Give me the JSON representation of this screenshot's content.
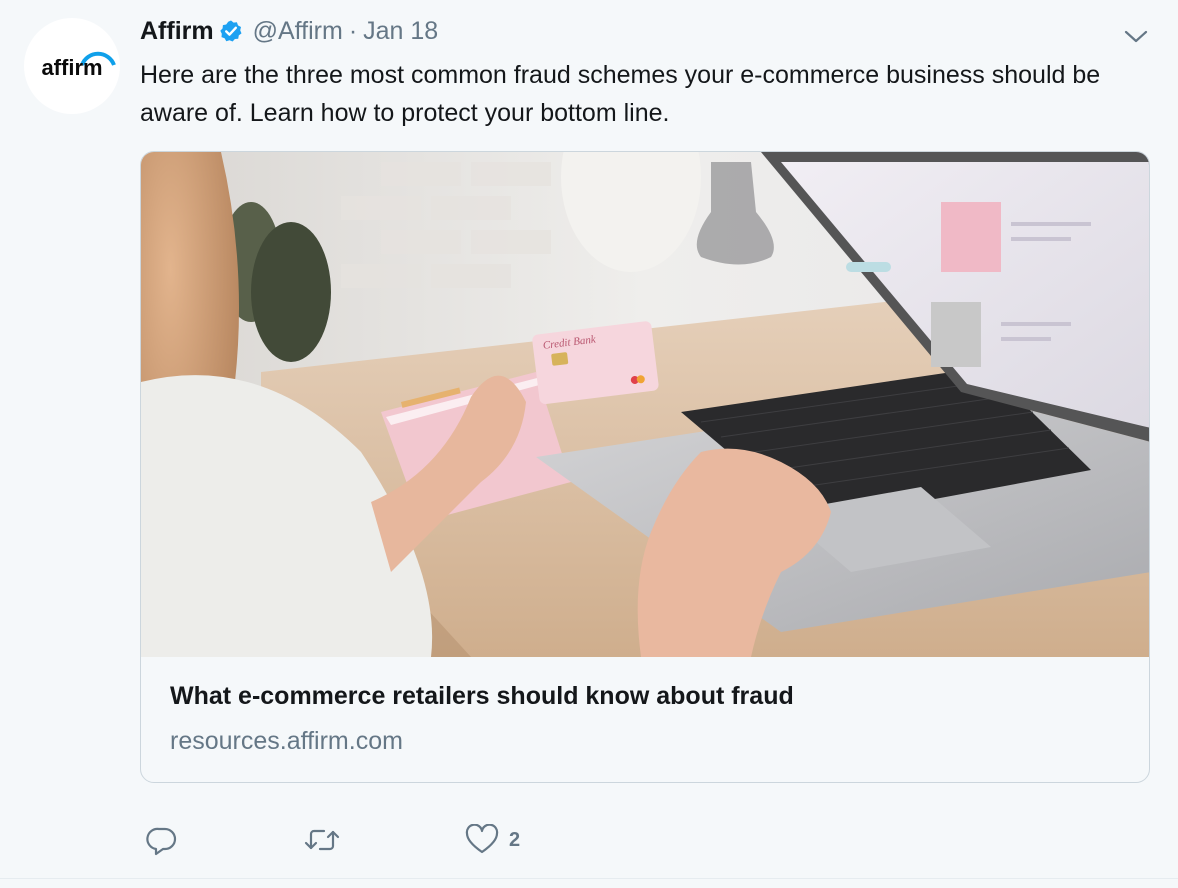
{
  "tweet": {
    "avatar_text": "affirm",
    "name": "Affirm",
    "handle": "@Affirm",
    "separator": "·",
    "date": "Jan 18",
    "text": "Here are the three most common fraud schemes your e-commerce business should be aware of. Learn how to protect your bottom line.",
    "card": {
      "image_card_text": "Credit Bank",
      "title": "What e-commerce retailers should know about fraud",
      "domain": "resources.affirm.com"
    },
    "actions": {
      "like_count": "2"
    }
  },
  "colors": {
    "background": "#f5f8fa",
    "text": "#14171a",
    "secondary": "#657786",
    "verified": "#1da1f2",
    "affirm_blue": "#0fa0ea",
    "border": "#ccd6dd"
  },
  "icons": [
    "verified-badge-icon",
    "chevron-down-icon",
    "reply-icon",
    "retweet-icon",
    "like-icon"
  ]
}
